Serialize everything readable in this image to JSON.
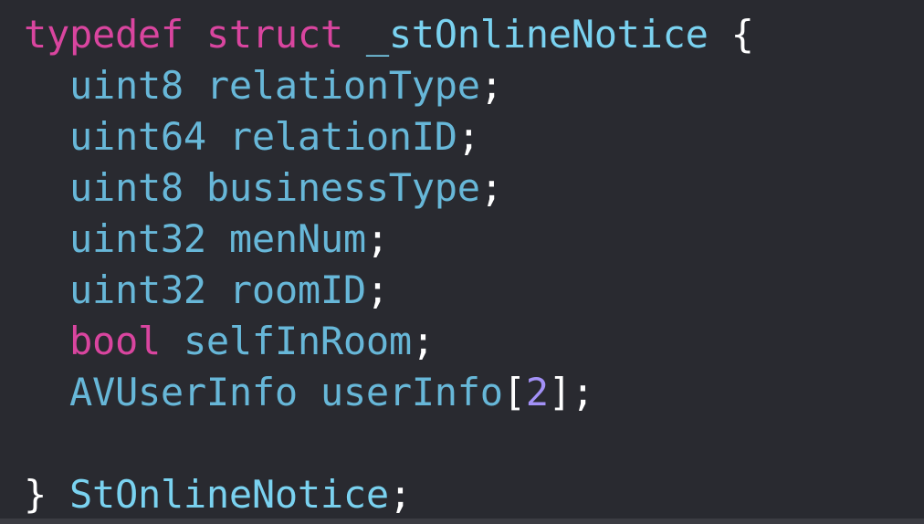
{
  "code": {
    "line1": {
      "kw_typedef": "typedef",
      "kw_struct": "struct",
      "struct_tag": "_stOnlineNotice",
      "open_brace": "{"
    },
    "fields": [
      {
        "type": "uint8",
        "name": "relationType",
        "suffix": ";"
      },
      {
        "type": "uint64",
        "name": "relationID",
        "suffix": ";"
      },
      {
        "type": "uint8",
        "name": "businessType",
        "suffix": ";"
      },
      {
        "type": "uint32",
        "name": "menNum",
        "suffix": ";"
      },
      {
        "type": "uint32",
        "name": "roomID",
        "suffix": ";"
      },
      {
        "type": "bool",
        "name": "selfInRoom",
        "suffix": ";"
      },
      {
        "type": "AVUserInfo",
        "name": "userInfo",
        "bracket_open": "[",
        "size": "2",
        "bracket_close": "]",
        "suffix": ";"
      }
    ],
    "closing": {
      "close_brace": "}",
      "alias": "StOnlineNotice",
      "suffix": ";"
    }
  },
  "colors": {
    "background": "#292a30",
    "keyword": "#fc5fa3",
    "type_name": "#5dd8ff",
    "identifier": "#67b7d8",
    "number": "#a391f7",
    "plain": "#ffffff"
  }
}
